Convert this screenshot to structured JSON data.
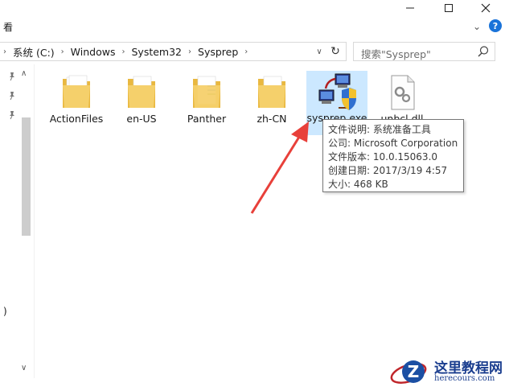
{
  "menu": {
    "view_label": "看"
  },
  "address": {
    "crumbs": [
      "系统 (C:)",
      "Windows",
      "System32",
      "Sysprep"
    ]
  },
  "search": {
    "placeholder": "搜索\"Sysprep\""
  },
  "nav": {
    "partial_text": ")"
  },
  "files": [
    {
      "name": "ActionFiles",
      "type": "folder"
    },
    {
      "name": "en-US",
      "type": "folder"
    },
    {
      "name": "Panther",
      "type": "folder"
    },
    {
      "name": "zh-CN",
      "type": "folder"
    },
    {
      "name": "sysprep.exe",
      "type": "exe",
      "selected": true
    },
    {
      "name": "unbcl.dll",
      "type": "dll"
    }
  ],
  "tooltip": {
    "desc": "文件说明: 系统准备工具",
    "company": "公司: Microsoft Corporation",
    "version": "文件版本: 10.0.15063.0",
    "created": "创建日期: 2017/3/19 4:57",
    "size": "大小: 468 KB"
  },
  "watermark": {
    "brand_cn": "这里教程网",
    "domain": "herecours.com"
  },
  "colors": {
    "selection": "#cce8ff",
    "arrow": "#e8403a",
    "folder": "#f5d06b",
    "accent": "#1a73d9"
  }
}
